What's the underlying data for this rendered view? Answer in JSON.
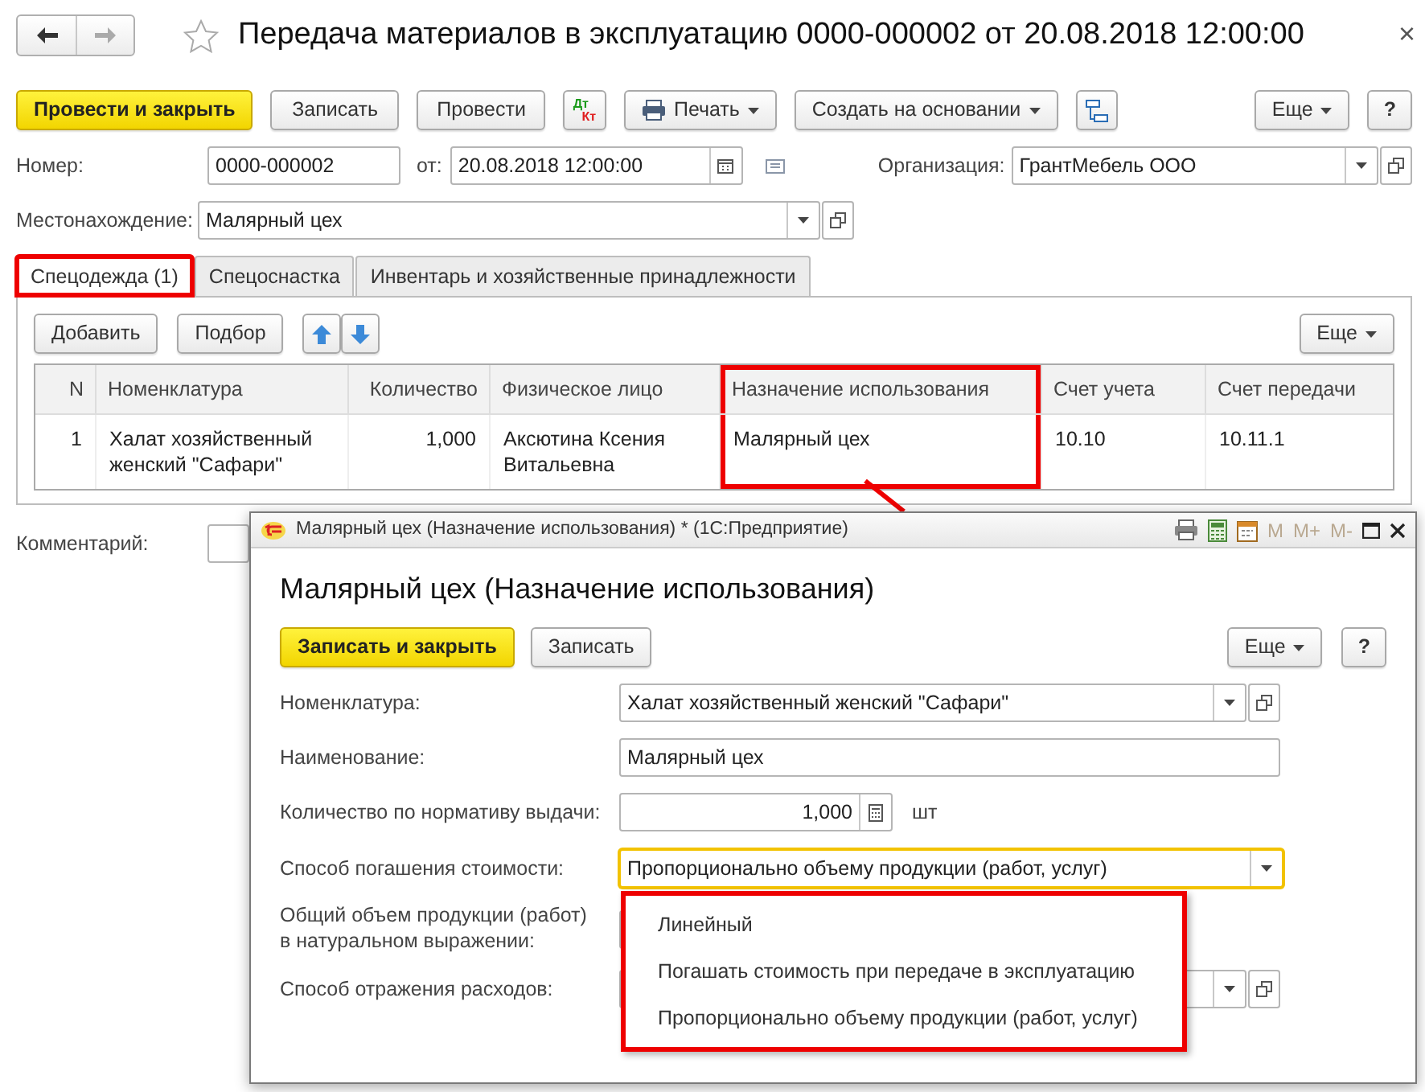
{
  "window": {
    "title": "Передача материалов в эксплуатацию 0000-000002 от 20.08.2018 12:00:00",
    "close": "×"
  },
  "toolbar": [
    {
      "kind": "primary",
      "label": "Провести и закрыть"
    },
    {
      "kind": "button",
      "label": "Записать"
    },
    {
      "kind": "button",
      "label": "Провести"
    },
    {
      "kind": "dtkt",
      "label_top": "Дт",
      "label_bottom": "Кт"
    },
    {
      "kind": "print",
      "label": "Печать"
    },
    {
      "kind": "menu",
      "label": "Создать на основании"
    },
    {
      "kind": "structure"
    },
    {
      "kind": "menu-right",
      "label": "Еще"
    },
    {
      "kind": "help",
      "label": "?"
    }
  ],
  "header_fields": {
    "number": {
      "label": "Номер:",
      "value": "0000-000002"
    },
    "date": {
      "label": "от:",
      "value": "20.08.2018 12:00:00"
    },
    "organization": {
      "label": "Организация:",
      "value": "ГрантМебель ООО"
    },
    "location": {
      "label": "Местонахождение:",
      "value": "Малярный цех"
    }
  },
  "tabs": [
    {
      "label": "Спецодежда (1)",
      "selected": true,
      "highlighted": true
    },
    {
      "label": "Спецоснастка",
      "selected": false,
      "highlighted": false
    },
    {
      "label": "Инвентарь и хозяйственные принадлежности",
      "selected": false,
      "highlighted": false
    }
  ],
  "table_toolbar": [
    {
      "kind": "button",
      "label": "Добавить"
    },
    {
      "kind": "button",
      "label": "Подбор"
    },
    {
      "kind": "up"
    },
    {
      "kind": "down"
    },
    {
      "kind": "menu-right",
      "label": "Еще"
    }
  ],
  "table": {
    "columns": [
      {
        "label": "N",
        "numeric": true,
        "highlighted": false
      },
      {
        "label": "Номенклатура",
        "numeric": false,
        "highlighted": false
      },
      {
        "label": "Количество",
        "numeric": true,
        "highlighted": false
      },
      {
        "label": "Физическое лицо",
        "numeric": false,
        "highlighted": false
      },
      {
        "label": "Назначение использования",
        "numeric": false,
        "highlighted": true
      },
      {
        "label": "Счет учета",
        "numeric": false,
        "highlighted": false
      },
      {
        "label": "Счет передачи",
        "numeric": false,
        "highlighted": false
      }
    ],
    "rows": [
      {
        "cells": [
          "1",
          "Халат хозяйственный женский \"Сафари\"",
          "1,000",
          "Аксютина Ксения Витальевна",
          "Малярный цех",
          "10.10",
          "10.11.1"
        ]
      }
    ]
  },
  "comment": {
    "label": "Комментарий:"
  },
  "dialog": {
    "title": "Малярный цех (Назначение использования) * (1С:Предприятие)",
    "memory_buttons": [
      "M",
      "M+",
      "M-"
    ],
    "heading": "Малярный цех (Назначение использования)",
    "buttons": [
      {
        "kind": "primary",
        "label": "Записать и закрыть"
      },
      {
        "kind": "button",
        "label": "Записать"
      },
      {
        "kind": "menu-right",
        "label": "Еще"
      },
      {
        "kind": "help",
        "label": "?"
      }
    ],
    "fields": [
      {
        "kind": "select",
        "label": "Номенклатура:",
        "value": "Халат хозяйственный женский \"Сафари\"",
        "focused": false
      },
      {
        "kind": "text",
        "label": "Наименование:",
        "value": "Малярный цех",
        "focused": false
      },
      {
        "kind": "number",
        "label": "Количество по нормативу выдачи:",
        "value": "1,000",
        "unit": "шт",
        "focused": false
      },
      {
        "kind": "dropdown",
        "label": "Способ погашения стоимости:",
        "value": "Пропорционально объему продукции (работ, услуг)",
        "focused": true
      },
      {
        "kind": "covered",
        "label": "Общий объем продукции (работ) в натуральном выражении:",
        "focused": false
      },
      {
        "kind": "covered-select",
        "label": "Способ отражения расходов:",
        "focused": false
      }
    ],
    "popup": {
      "highlighted": true,
      "options": [
        "Линейный",
        "Погашать стоимость при передаче в эксплуатацию",
        "Пропорционально объему продукции (работ, услуг)"
      ]
    }
  }
}
